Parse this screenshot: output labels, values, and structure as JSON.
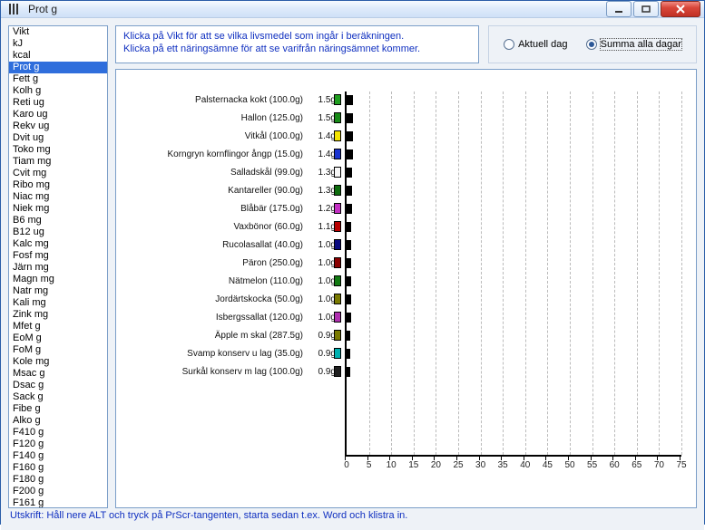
{
  "window": {
    "title": "Prot g"
  },
  "instructions": {
    "line1": "Klicka på Vikt för att se vilka livsmedel som ingår i beräkningen.",
    "line2": "Klicka på ett näringsämne för att se varifrån näringsämnet kommer."
  },
  "radios": {
    "aktuell": "Aktuell dag",
    "summa": "Summa alla dagar",
    "selected": "summa"
  },
  "sidebar": {
    "selected": "Prot g",
    "items": [
      "Vikt",
      "kJ",
      "kcal",
      "Prot g",
      "Fett g",
      "Kolh g",
      "Reti ug",
      "Karo ug",
      "Rekv ug",
      "Dvit ug",
      "Toko mg",
      "Tiam mg",
      "Cvit mg",
      "Ribo mg",
      "Niac mg",
      "Niek mg",
      "B6 mg",
      "B12 ug",
      "Kalc mg",
      "Fosf mg",
      "Järn mg",
      "Magn mg",
      "Natr mg",
      "Kali mg",
      "Zink mg",
      "Mfet g",
      "EoM g",
      "FoM g",
      "Kole mg",
      "Msac g",
      "Dsac g",
      "Sack g",
      "Fibe g",
      "Alko g",
      "F410 g",
      "F120 g",
      "F140 g",
      "F160 g",
      "F180 g",
      "F200 g",
      "F161 g"
    ]
  },
  "footer": "Utskrift: Håll nere ALT och tryck på PrScr-tangenten, starta sedan t.ex. Word och klistra in.",
  "chart_data": {
    "type": "bar",
    "orientation": "horizontal",
    "xlabel": "",
    "ylabel": "",
    "xlim": [
      0,
      75
    ],
    "xticks": [
      0,
      5,
      10,
      15,
      20,
      25,
      30,
      35,
      40,
      45,
      50,
      55,
      60,
      65,
      70,
      75
    ],
    "rows": [
      {
        "label": "Palsternacka kokt (100.0g)",
        "value": 1.5,
        "value_label": "1.5g",
        "color": "#1f9e1f"
      },
      {
        "label": "Hallon (125.0g)",
        "value": 1.5,
        "value_label": "1.5g",
        "color": "#178a17"
      },
      {
        "label": "Vitkål (100.0g)",
        "value": 1.4,
        "value_label": "1.4g",
        "color": "#f4e400"
      },
      {
        "label": "Korngryn kornflingor ångp (15.0g)",
        "value": 1.4,
        "value_label": "1.4g",
        "color": "#1a34d0"
      },
      {
        "label": "Salladskål (99.0g)",
        "value": 1.3,
        "value_label": "1.3g",
        "color": "#f7f7f7"
      },
      {
        "label": "Kantareller (90.0g)",
        "value": 1.3,
        "value_label": "1.3g",
        "color": "#0e6d0e"
      },
      {
        "label": "Blåbär (175.0g)",
        "value": 1.2,
        "value_label": "1.2g",
        "color": "#c430c4"
      },
      {
        "label": "Vaxbönor (60.0g)",
        "value": 1.1,
        "value_label": "1.1g",
        "color": "#b80000"
      },
      {
        "label": "Rucolasallat (40.0g)",
        "value": 1.0,
        "value_label": "1.0g",
        "color": "#0a0a80"
      },
      {
        "label": "Päron (250.0g)",
        "value": 1.0,
        "value_label": "1.0g",
        "color": "#8a0000"
      },
      {
        "label": "Nätmelon (110.0g)",
        "value": 1.0,
        "value_label": "1.0g",
        "color": "#127a12"
      },
      {
        "label": "Jordärtskocka (50.0g)",
        "value": 1.0,
        "value_label": "1.0g",
        "color": "#7a7a00"
      },
      {
        "label": "Isbergssallat (120.0g)",
        "value": 1.0,
        "value_label": "1.0g",
        "color": "#b030b0"
      },
      {
        "label": "Äpple m skal (287.5g)",
        "value": 0.9,
        "value_label": "0.9g",
        "color": "#7a7a00"
      },
      {
        "label": "Svamp konserv u lag (35.0g)",
        "value": 0.9,
        "value_label": "0.9g",
        "color": "#00b0b0"
      },
      {
        "label": "Surkål konserv m lag (100.0g)",
        "value": 0.9,
        "value_label": "0.9g",
        "color": "#202020"
      }
    ]
  }
}
